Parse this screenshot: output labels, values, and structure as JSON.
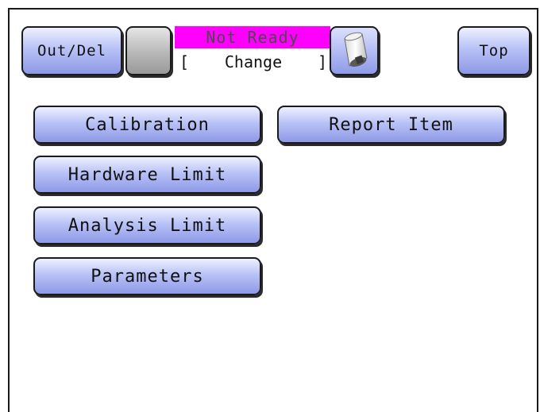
{
  "header": {
    "out_del_label": "Out/Del",
    "status_text": "Not Ready",
    "mode_open": "[",
    "mode_text": "Change",
    "mode_close": "]",
    "top_label": "Top",
    "device_icon": "sample-cylinder-icon"
  },
  "menu": {
    "calibration": "Calibration",
    "report_item": "Report Item",
    "hardware_limit": "Hardware Limit",
    "analysis_limit": "Analysis Limit",
    "parameters": "Parameters"
  },
  "colors": {
    "status_bg": "#ff00ff",
    "button_blue": "#8d99e6"
  }
}
